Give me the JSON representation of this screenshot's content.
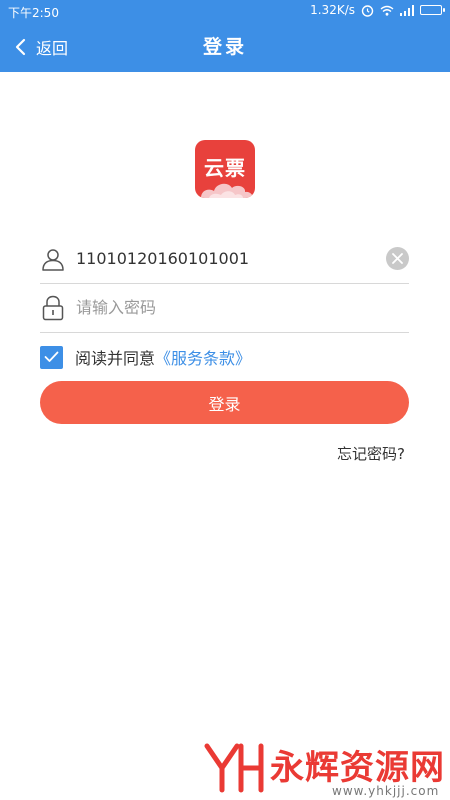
{
  "status_bar": {
    "time": "下午2:50",
    "network_speed": "1.32K/s"
  },
  "navbar": {
    "back_label": "返回",
    "title": "登录"
  },
  "logo": {
    "text": "云票"
  },
  "form": {
    "username_value": "11010120160101001",
    "password_placeholder": "请输入密码"
  },
  "agreement": {
    "text": "阅读并同意",
    "link": "《服务条款》",
    "checked": true
  },
  "login_button_label": "登录",
  "forgot_password_label": "忘记密码?",
  "watermark": {
    "name": "永辉资源网",
    "url": "www.yhkjjj.com"
  },
  "colors": {
    "primary": "#3d8fe6",
    "button": "#f5614b",
    "logo": "#e8413c"
  }
}
